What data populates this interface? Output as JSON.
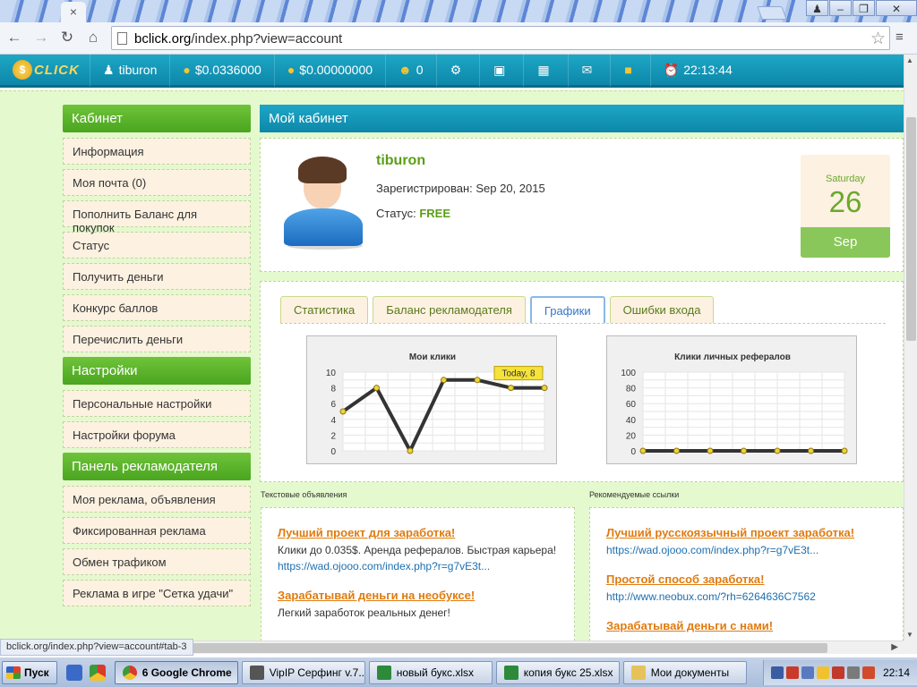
{
  "browser": {
    "url_host": "bclick.org",
    "url_path": "/index.php?view=account",
    "tab_close": "×"
  },
  "site": {
    "logo_text": "CLICK",
    "username": "tiburon",
    "balance1": "$0.0336000",
    "balance2": "$0.00000000",
    "referrals": "0",
    "time": "22:13:44"
  },
  "sidebar": {
    "cabinet_title": "Кабинет",
    "cabinet_items": [
      "Информация",
      "Моя почта (0)",
      "Пополнить Баланс для покупок",
      "Статус",
      "Получить деньги",
      "Конкурс баллов",
      "Перечислить деньги"
    ],
    "settings_title": "Настройки",
    "settings_items": [
      "Персональные настройки",
      "Настройки форума"
    ],
    "advertiser_title": "Панель рекламодателя",
    "advertiser_items": [
      "Моя реклама, объявления",
      "Фиксированная реклама",
      "Обмен трафиком",
      "Реклама в игре \"Сетка удачи\""
    ]
  },
  "main": {
    "title": "Мой кабинет",
    "profile": {
      "username": "tiburon",
      "registered_label": "Зарегистрирован:",
      "registered_date": "Sep 20, 2015",
      "status_label": "Статус:",
      "status_value": "FREE"
    },
    "date": {
      "weekday": "Saturday",
      "day": "26",
      "month": "Sep"
    },
    "tabs": [
      "Статистика",
      "Баланс рекламодателя",
      "Графики",
      "Ошибки входа"
    ],
    "active_tab": 2
  },
  "chart_data": [
    {
      "type": "line",
      "title": "Мои клики",
      "x": [
        1,
        2,
        3,
        4,
        5,
        6,
        7
      ],
      "values": [
        5,
        8,
        0,
        9,
        9,
        8,
        8
      ],
      "ylim": [
        0,
        10
      ],
      "yticks": [
        0,
        2,
        4,
        6,
        8,
        10
      ],
      "tooltip": "Today, 8",
      "grid": true
    },
    {
      "type": "line",
      "title": "Клики личных рефералов",
      "x": [
        1,
        2,
        3,
        4,
        5,
        6,
        7
      ],
      "values": [
        0,
        0,
        0,
        0,
        0,
        0,
        0
      ],
      "ylim": [
        0,
        100
      ],
      "yticks": [
        0,
        20,
        40,
        60,
        80,
        100
      ],
      "grid": true
    }
  ],
  "ads": {
    "text_label": "Текстовые объявления",
    "text_items": [
      {
        "title": "Лучший проект для заработка!",
        "desc": "Клики до 0.035$. Аренда рефералов. Быстрая карьера!",
        "link": "https://wad.ojooo.com/index.php?r=g7vE3t..."
      },
      {
        "title": "Зарабатывай деньги на необуксе!",
        "desc": "Легкий заработок реальных денег!",
        "link": ""
      }
    ],
    "links_label": "Рекомендуемые ссылки",
    "link_items": [
      {
        "title": "Лучший русскоязычный проект заработка!",
        "link": "https://wad.ojooo.com/index.php?r=g7vE3t..."
      },
      {
        "title": "Простой способ заработка!",
        "link": "http://www.neobux.com/?rh=6264636C7562"
      },
      {
        "title": "Зарабатывай деньги с нами!",
        "link": ""
      }
    ]
  },
  "statusbar": "bclick.org/index.php?view=account#tab-3",
  "taskbar": {
    "start": "Пуск",
    "tasks": [
      "6 Google Chrome",
      "VipIP Серфинг v.7...",
      "новый букс.xlsx",
      "копия букс 25.xlsx",
      "Мои документы"
    ],
    "clock": "22:14"
  },
  "colors": {
    "accent_green": "#4aa51e",
    "accent_teal": "#0d87a9",
    "page_bg": "#e5f9cf",
    "ad_title": "#e07b0e"
  }
}
